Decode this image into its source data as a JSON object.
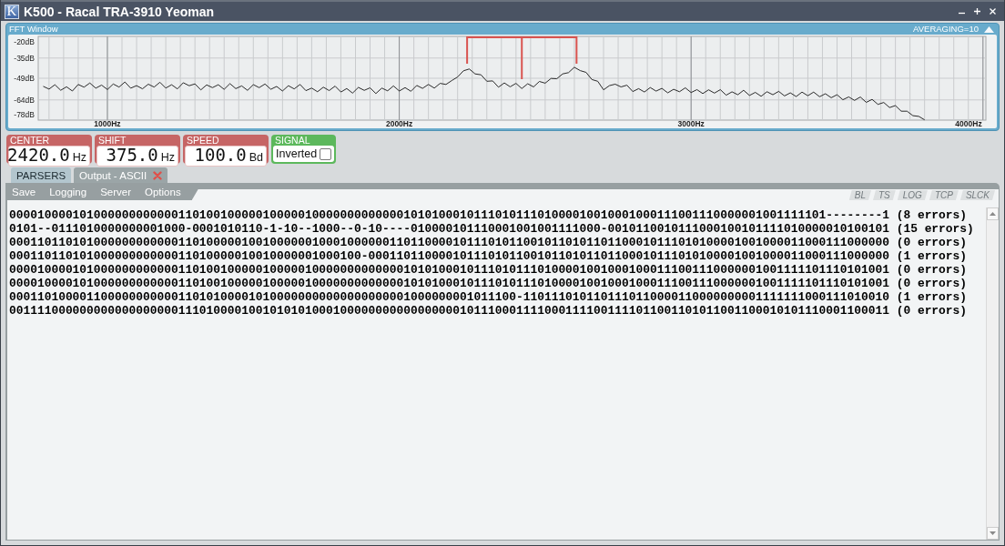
{
  "window": {
    "logo": "K",
    "title": "K500 - Racal TRA-3910 Yeoman"
  },
  "fft_window": {
    "title": "FFT Window",
    "averaging": "AVERAGING=10",
    "chart_data": {
      "type": "line",
      "grid": true,
      "x": [
        780,
        800,
        820,
        840,
        860,
        880,
        900,
        920,
        940,
        960,
        980,
        1000,
        1020,
        1040,
        1060,
        1080,
        1100,
        1120,
        1140,
        1160,
        1180,
        1200,
        1220,
        1240,
        1260,
        1280,
        1300,
        1320,
        1340,
        1360,
        1380,
        1400,
        1420,
        1440,
        1460,
        1480,
        1500,
        1520,
        1540,
        1560,
        1580,
        1600,
        1620,
        1640,
        1660,
        1680,
        1700,
        1720,
        1740,
        1760,
        1780,
        1800,
        1820,
        1840,
        1860,
        1880,
        1900,
        1920,
        1940,
        1960,
        1980,
        2000,
        2020,
        2040,
        2060,
        2080,
        2100,
        2120,
        2140,
        2160,
        2180,
        2200,
        2220,
        2240,
        2260,
        2280,
        2300,
        2320,
        2340,
        2360,
        2380,
        2400,
        2420,
        2440,
        2460,
        2480,
        2500,
        2520,
        2540,
        2560,
        2580,
        2600,
        2620,
        2640,
        2660,
        2680,
        2700,
        2720,
        2740,
        2760,
        2780,
        2800,
        2820,
        2840,
        2860,
        2880,
        2900,
        2920,
        2940,
        2960,
        2980,
        3000,
        3020,
        3040,
        3060,
        3080,
        3100,
        3120,
        3140,
        3160,
        3180,
        3200,
        3220,
        3240,
        3260,
        3280,
        3300,
        3320,
        3340,
        3360,
        3380,
        3400,
        3420,
        3440,
        3460,
        3480,
        3500,
        3520,
        3540,
        3560,
        3580,
        3600,
        3620,
        3640,
        3660,
        3680,
        3700,
        3720,
        3740,
        3760,
        3780,
        3800
      ],
      "series": [
        {
          "color": "#2a2a2a",
          "values": [
            -54.6,
            -56.5,
            -53.5,
            -57.3,
            -54.9,
            -57.8,
            -53.3,
            -55.2,
            -52.3,
            -55.9,
            -53.7,
            -56.8,
            -53.0,
            -55.1,
            -51.6,
            -55.9,
            -54.1,
            -56.3,
            -53.1,
            -55.1,
            -51.8,
            -55.8,
            -53.5,
            -56.4,
            -52.1,
            -54.2,
            -52.9,
            -57.1,
            -53.6,
            -55.5,
            -53.5,
            -56.7,
            -52.7,
            -56.2,
            -54.3,
            -57.4,
            -53.4,
            -55.5,
            -53.0,
            -56.6,
            -54.7,
            -57.8,
            -54.2,
            -56.4,
            -53.3,
            -57.6,
            -55.8,
            -58.3,
            -55.2,
            -57.5,
            -54.4,
            -58.5,
            -56.1,
            -59.3,
            -55.3,
            -57.4,
            -55.6,
            -59.6,
            -55.8,
            -57.7,
            -54.3,
            -57.8,
            -55.5,
            -58.0,
            -54.0,
            -56.0,
            -53.3,
            -55.8,
            -52.5,
            -53.3,
            -50.6,
            -48.1,
            -43.8,
            -42.6,
            -46.0,
            -46.6,
            -51.1,
            -50.8,
            -55.2,
            -52.2,
            -54.9,
            -52.5,
            -56.1,
            -52.8,
            -55.0,
            -51.2,
            -52.4,
            -49.1,
            -49.3,
            -46.0,
            -45.1,
            -41.4,
            -43.7,
            -44.9,
            -49.9,
            -51.1,
            -57.0,
            -54.1,
            -53.1,
            -55.0,
            -53.8,
            -58.2,
            -56.2,
            -58.5,
            -55.4,
            -57.9,
            -56.0,
            -59.1,
            -56.6,
            -58.3,
            -55.6,
            -58.9,
            -56.9,
            -59.6,
            -57.0,
            -59.3,
            -56.9,
            -60.7,
            -58.4,
            -60.4,
            -57.3,
            -60.9,
            -58.8,
            -61.5,
            -58.3,
            -60.4,
            -58.1,
            -61.2,
            -59.1,
            -61.7,
            -58.6,
            -61.1,
            -58.6,
            -61.8,
            -59.7,
            -62.5,
            -60.4,
            -63.9,
            -61.9,
            -64.3,
            -62.0,
            -65.7,
            -63.6,
            -67.1,
            -65.8,
            -69.3,
            -67.9,
            -71.8,
            -71.8,
            -74.9,
            -75.4,
            -77.8
          ]
        }
      ],
      "xlim": [
        763,
        4010
      ],
      "ylim": [
        -78,
        -20
      ],
      "xticks": [
        {
          "value": 1000,
          "label": "1000Hz"
        },
        {
          "value": 2000,
          "label": "2000Hz"
        },
        {
          "value": 3000,
          "label": "3000Hz"
        },
        {
          "value": 4000,
          "label": "4000Hz"
        }
      ],
      "yticks": [
        {
          "value": -20,
          "label": "-20dB"
        },
        {
          "value": -35,
          "label": "-35dB"
        },
        {
          "value": -49,
          "label": "-49dB"
        },
        {
          "value": -64,
          "label": "-64dB"
        },
        {
          "value": -78,
          "label": "-78dB"
        }
      ]
    }
  },
  "parameters": [
    {
      "kind": "value",
      "label": "CENTER",
      "value": "2420.0",
      "unit": "Hz"
    },
    {
      "kind": "value",
      "label": "SHIFT",
      "value": "375.0",
      "unit": "Hz"
    },
    {
      "kind": "value",
      "label": "SPEED",
      "value": "100.0",
      "unit": "Bd"
    },
    {
      "kind": "toggle",
      "label": "SIGNAL",
      "option": "Inverted",
      "checked": false
    }
  ],
  "tabs": [
    {
      "label": "PARSERS",
      "selected": false,
      "closable": false
    },
    {
      "label": "Output - ASCII",
      "selected": true,
      "closable": true
    }
  ],
  "menu": [
    "Save",
    "Logging",
    "Server",
    "Options"
  ],
  "flags": [
    {
      "label": "BL",
      "on": false
    },
    {
      "label": "TS",
      "on": false
    },
    {
      "label": "LOG",
      "on": false
    },
    {
      "label": "TCP",
      "on": false
    },
    {
      "label": "SLCK",
      "on": false
    }
  ],
  "output_lines": [
    "00001000010100000000000011010010000010000010000000000000101010001011101011101000010010001000111001110000001001111101--------1 (8 errors)",
    "0101--0111010000000001000-0001010110-1-10--1000--0-10----010000101110001001001111000-0010110010111000100101111010000010100101 (15 errors)",
    "00011011010100000000000011010000010010000001000100000011011000010111010110010110101101100010111010100001001000011000111000000 (0 errors)",
    "00011011010100000000000011010000010010000001000100-00011011000010111010110010110101101100010111010100001001000011000111000000 (1 errors)",
    "00001000010100000000000011010010000010000010000000000000101010001011101011101000010010001000111001110000001001111101110101001 (0 errors)",
    "00001000010100000000000011010010000010000010000000000000101010001011101011101000010010001000111001110000001001111101110101001 (0 errors)",
    "000110100001100000000000110101000010100000000000000000001000000001011100-1101110101101110110000110000000001111111000111010010 (1 errors)",
    "00111100000000000000000011101000010010101010001000000000000000001011100011110001111001111011001101011001100010101110001100011 (0 errors)"
  ]
}
